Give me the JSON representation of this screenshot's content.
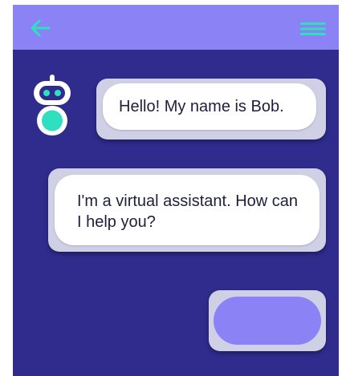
{
  "colors": {
    "background": "#2f2c8e",
    "header": "#8b82f5",
    "accent": "#2ee0c0",
    "bubble": "#ffffff",
    "bubble_frame": "#cfd0e6",
    "input": "#8b82f5"
  },
  "header": {
    "back_icon": "arrow-left-icon",
    "menu_icon": "hamburger-menu-icon"
  },
  "bot": {
    "avatar_icon": "robot-icon"
  },
  "messages": [
    {
      "sender": "bot",
      "text": "Hello! My name is Bob."
    },
    {
      "sender": "bot",
      "text": "I'm a virtual assistant. How can I help you?"
    }
  ],
  "reply": {
    "value": ""
  }
}
